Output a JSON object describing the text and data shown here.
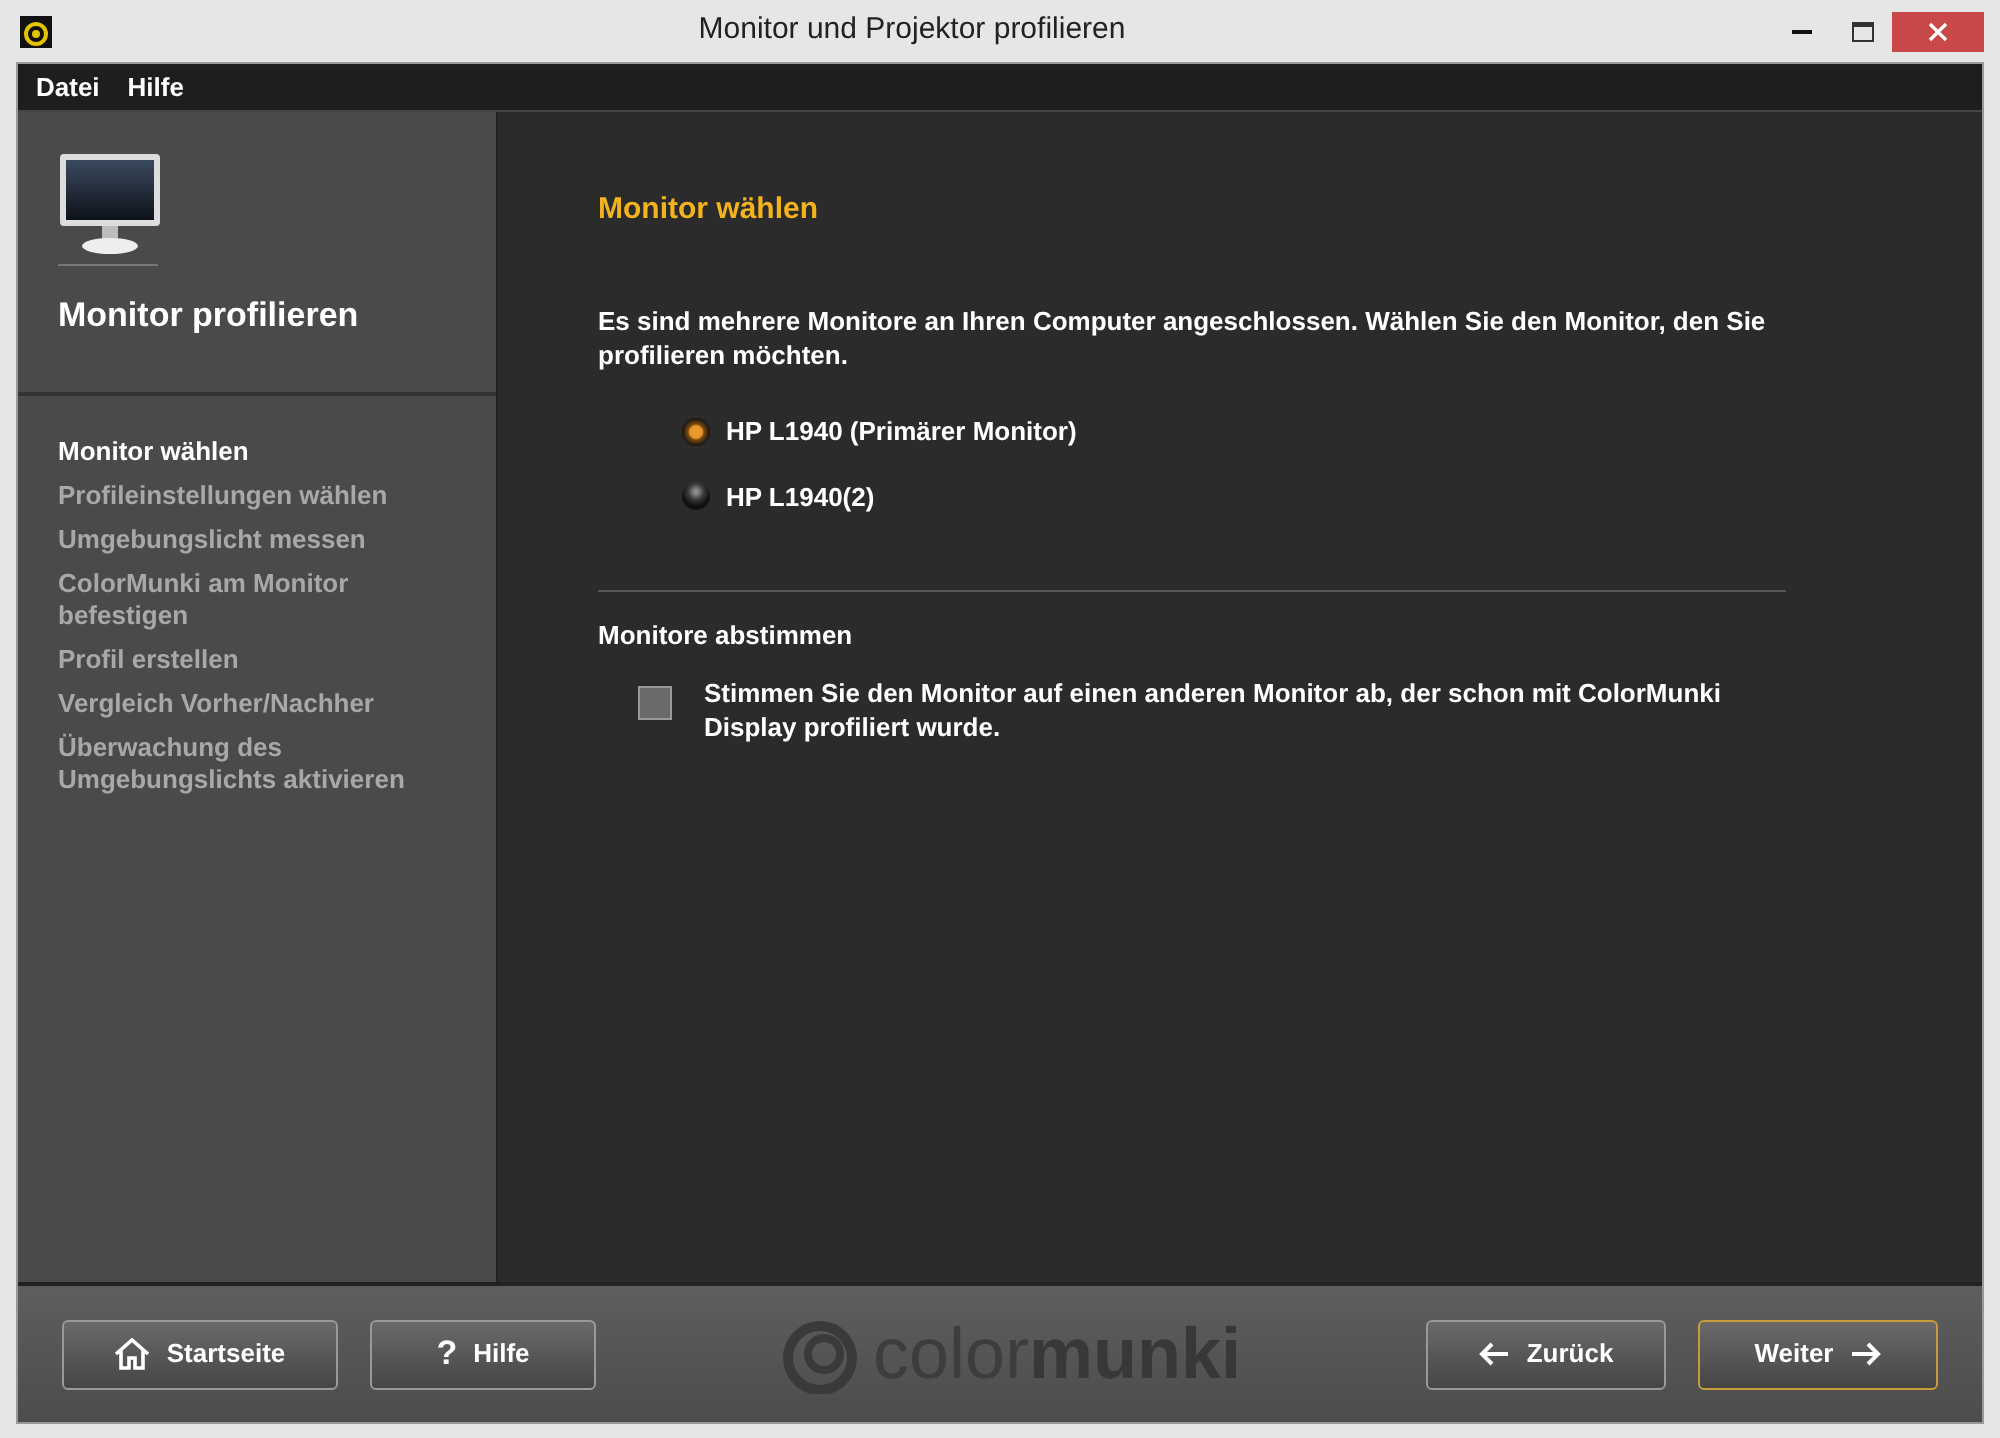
{
  "window": {
    "title": "Monitor und Projektor profilieren"
  },
  "menu": [
    "Datei",
    "Hilfe"
  ],
  "sidebar": {
    "title": "Monitor profilieren",
    "steps": [
      {
        "label": "Monitor wählen",
        "selected": true
      },
      {
        "label": "Profileinstellungen wählen",
        "selected": false
      },
      {
        "label": "Umgebungslicht messen",
        "selected": false
      },
      {
        "label": "ColorMunki am Monitor befestigen",
        "selected": false
      },
      {
        "label": "Profil erstellen",
        "selected": false
      },
      {
        "label": "Vergleich Vorher/Nachher",
        "selected": false
      },
      {
        "label": "Überwachung des Umgebungslichts aktivieren",
        "selected": false
      }
    ]
  },
  "main": {
    "heading": "Monitor wählen",
    "description": "Es sind mehrere Monitore an Ihren Computer angeschlossen. Wählen Sie den Monitor, den Sie profilieren möchten.",
    "monitors": [
      {
        "label": "HP L1940 (Primärer Monitor)",
        "selected": true
      },
      {
        "label": "HP L1940(2)",
        "selected": false
      }
    ],
    "match_section": {
      "title": "Monitore abstimmen",
      "option": {
        "label": "Stimmen Sie den Monitor auf einen anderen Monitor ab, der schon mit ColorMunki Display profiliert wurde.",
        "checked": false
      }
    }
  },
  "footer": {
    "left_buttons": [
      {
        "kind": "home",
        "label": "Startseite"
      },
      {
        "kind": "glyph",
        "glyph": "?",
        "label": "Hilfe"
      }
    ],
    "logo_text": "color**munki**",
    "right_buttons": [
      {
        "kind": "back",
        "label": "Zurück",
        "focused": false
      },
      {
        "kind": "next",
        "label": "Weiter",
        "focused": true
      }
    ]
  }
}
